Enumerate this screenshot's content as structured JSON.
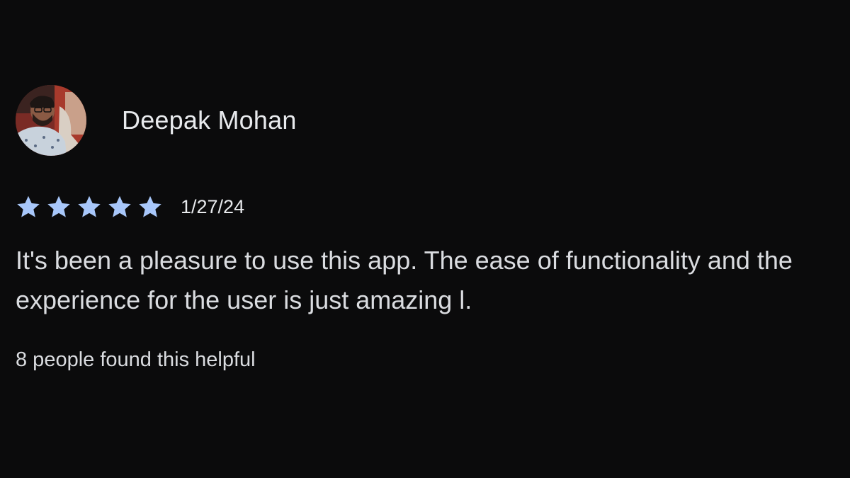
{
  "review": {
    "reviewer_name": "Deepak Mohan",
    "avatar_icon": "user-avatar-photo",
    "rating": 5,
    "rating_max": 5,
    "star_color": "#a8c7fa",
    "date": "1/27/24",
    "text": "It's been a pleasure to use this app. The ease of functionality and the experience for the user is just amazing l.",
    "helpful": "8 people found this helpful"
  },
  "colors": {
    "background": "#0b0b0c",
    "text_primary": "#e8eaed",
    "text_secondary": "#dadce0"
  }
}
